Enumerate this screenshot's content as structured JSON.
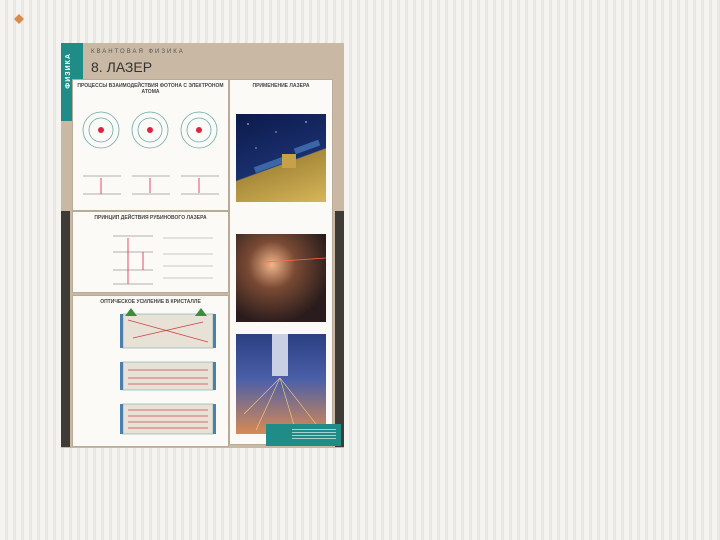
{
  "poster": {
    "top_label": "КВАНТОВАЯ ФИЗИКА",
    "title": "8. ЛАЗЕР",
    "side_tab": "ФИЗИКА",
    "panels": {
      "processes_head": "ПРОЦЕССЫ ВЗАИМОДЕЙСТВИЯ ФОТОНА С ЭЛЕКТРОНОМ АТОМА",
      "ruby_head": "ПРИНЦИП ДЕЙСТВИЯ РУБИНОВОГО ЛАЗЕРА",
      "amplification_head": "ОПТИЧЕСКОЕ УСИЛЕНИЕ В КРИСТАЛЛЕ",
      "applications_head": "ПРИМЕНЕНИЕ ЛАЗЕРА"
    },
    "colors": {
      "poster_bg": "#c9b9a4",
      "teal": "#1f8c87",
      "dark_strip": "#3f3b37"
    }
  }
}
